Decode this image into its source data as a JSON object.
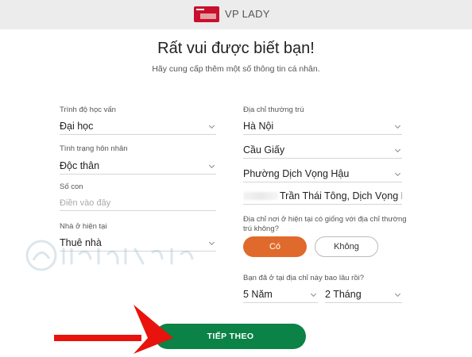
{
  "header": {
    "brand": "VP LADY",
    "logo_icon": "credit-card-icon",
    "brand_color": "#c8102e"
  },
  "intro": {
    "title": "Rất vui được biết bạn!",
    "subtitle": "Hãy cung cấp thêm một số thông tin cá nhân."
  },
  "form": {
    "education": {
      "label": "Trình độ học vấn",
      "value": "Đại học"
    },
    "marital": {
      "label": "Tình trạng hôn nhân",
      "value": "Độc thân"
    },
    "children": {
      "label": "Số con",
      "placeholder": "Điền vào đây"
    },
    "housing": {
      "label": "Nhà ở hiện tại",
      "value": "Thuê nhà"
    },
    "permanent_address": {
      "label": "Địa chỉ thường trú",
      "city": "Hà Nội",
      "district": "Cầu Giấy",
      "ward": "Phường Dịch Vọng Hậu",
      "street": "Trần Thái Tông, Dịch Vọng H"
    },
    "same_address": {
      "question": "Địa chỉ nơi ở hiện tại có giống với địa chỉ thường trú không?",
      "yes": "Có",
      "no": "Không"
    },
    "duration": {
      "question": "Bạn đã ở tại địa chỉ này bao lâu rồi?",
      "years": "5 Năm",
      "months": "2 Tháng"
    }
  },
  "actions": {
    "next": "TIẾP THEO"
  },
  "colors": {
    "accent_orange": "#e06a2b",
    "primary_green": "#0b8246",
    "annotation_red": "#e8130c"
  }
}
